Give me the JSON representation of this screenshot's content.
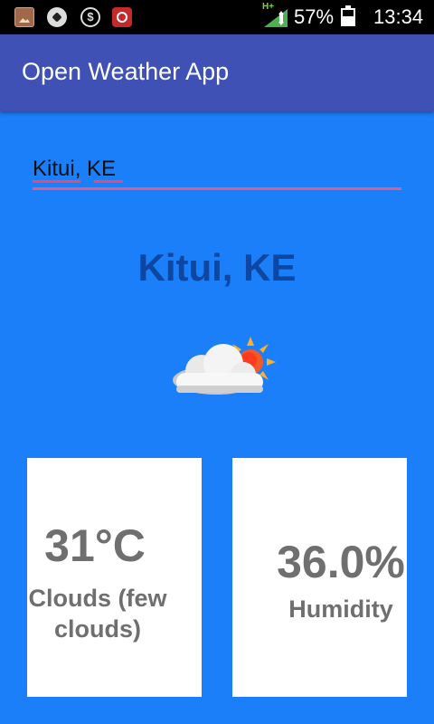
{
  "status_bar": {
    "network": "H+",
    "battery_percent": "57%",
    "battery_level": 0.57,
    "time": "13:34",
    "notification_icons": [
      "gallery-icon",
      "soccer-ball-icon",
      "dollar-icon",
      "target-icon"
    ]
  },
  "app_bar": {
    "title": "Open Weather App"
  },
  "search": {
    "value": "Kitui, KE"
  },
  "weather": {
    "city": "Kitui, KE",
    "icon": "few-clouds-icon",
    "temperature": "31°C",
    "description": "Clouds (few clouds)",
    "humidity_value": "36.0%",
    "humidity_label": "Humidity"
  },
  "colors": {
    "background": "#1a7ff8",
    "app_bar": "#3f51b5",
    "city_text": "#0d47a1",
    "card_text": "#6f6f6f",
    "input_underline": "#e25c86"
  }
}
